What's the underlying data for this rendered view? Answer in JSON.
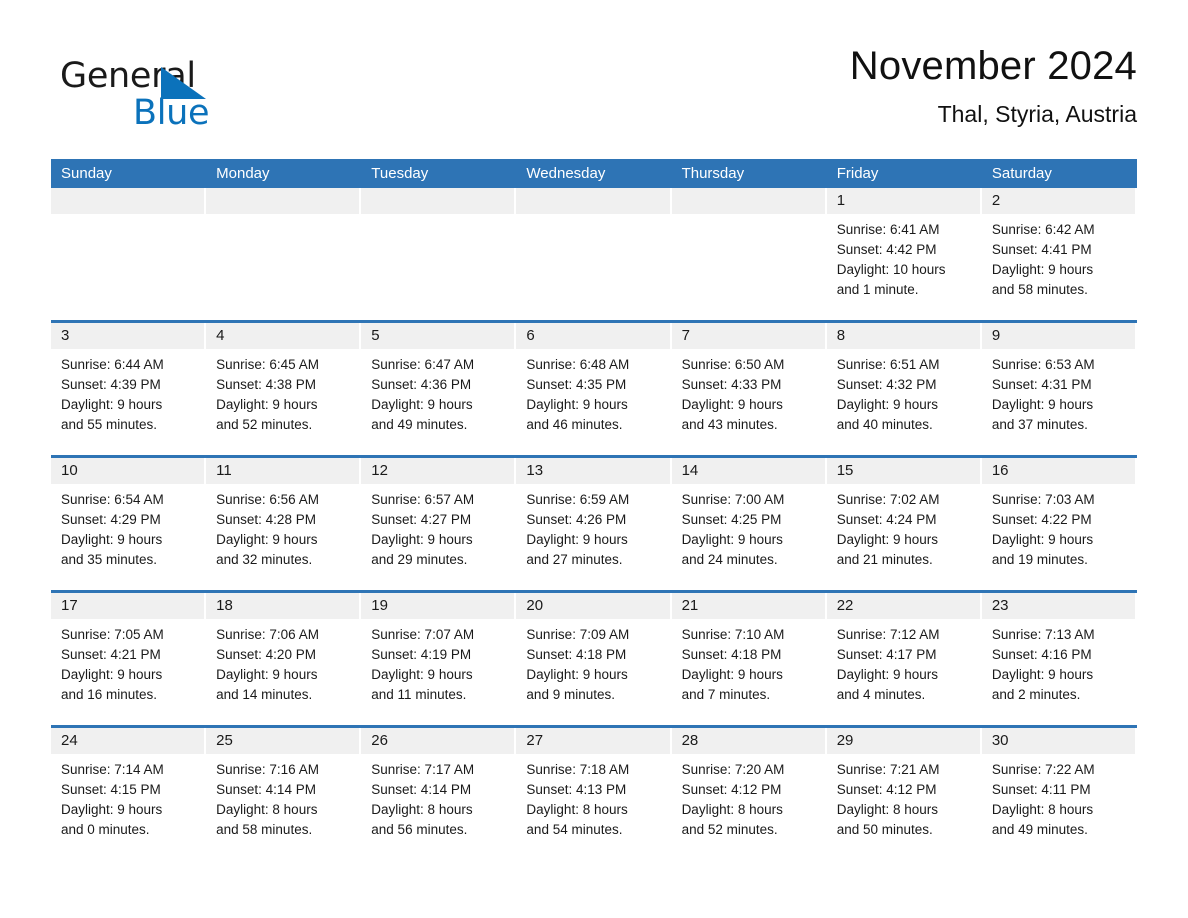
{
  "logo": {
    "word_one": "General",
    "word_two": "Blue",
    "triangle_icon": "triangle-icon",
    "brand_blue": "#0b72bb"
  },
  "header": {
    "title": "November 2024",
    "subtitle": "Thal, Styria, Austria"
  },
  "theme": {
    "header_blue": "#2e74b5",
    "daynum_band": "#f0f0f0",
    "text": "#1a1a1a"
  },
  "weekdays": [
    "Sunday",
    "Monday",
    "Tuesday",
    "Wednesday",
    "Thursday",
    "Friday",
    "Saturday"
  ],
  "weeks": [
    [
      {
        "empty": true
      },
      {
        "empty": true
      },
      {
        "empty": true
      },
      {
        "empty": true
      },
      {
        "empty": true
      },
      {
        "day": "1",
        "sunrise": "Sunrise: 6:41 AM",
        "sunset": "Sunset: 4:42 PM",
        "daylight_line1": "Daylight: 10 hours",
        "daylight_line2": "and 1 minute."
      },
      {
        "day": "2",
        "sunrise": "Sunrise: 6:42 AM",
        "sunset": "Sunset: 4:41 PM",
        "daylight_line1": "Daylight: 9 hours",
        "daylight_line2": "and 58 minutes."
      }
    ],
    [
      {
        "day": "3",
        "sunrise": "Sunrise: 6:44 AM",
        "sunset": "Sunset: 4:39 PM",
        "daylight_line1": "Daylight: 9 hours",
        "daylight_line2": "and 55 minutes."
      },
      {
        "day": "4",
        "sunrise": "Sunrise: 6:45 AM",
        "sunset": "Sunset: 4:38 PM",
        "daylight_line1": "Daylight: 9 hours",
        "daylight_line2": "and 52 minutes."
      },
      {
        "day": "5",
        "sunrise": "Sunrise: 6:47 AM",
        "sunset": "Sunset: 4:36 PM",
        "daylight_line1": "Daylight: 9 hours",
        "daylight_line2": "and 49 minutes."
      },
      {
        "day": "6",
        "sunrise": "Sunrise: 6:48 AM",
        "sunset": "Sunset: 4:35 PM",
        "daylight_line1": "Daylight: 9 hours",
        "daylight_line2": "and 46 minutes."
      },
      {
        "day": "7",
        "sunrise": "Sunrise: 6:50 AM",
        "sunset": "Sunset: 4:33 PM",
        "daylight_line1": "Daylight: 9 hours",
        "daylight_line2": "and 43 minutes."
      },
      {
        "day": "8",
        "sunrise": "Sunrise: 6:51 AM",
        "sunset": "Sunset: 4:32 PM",
        "daylight_line1": "Daylight: 9 hours",
        "daylight_line2": "and 40 minutes."
      },
      {
        "day": "9",
        "sunrise": "Sunrise: 6:53 AM",
        "sunset": "Sunset: 4:31 PM",
        "daylight_line1": "Daylight: 9 hours",
        "daylight_line2": "and 37 minutes."
      }
    ],
    [
      {
        "day": "10",
        "sunrise": "Sunrise: 6:54 AM",
        "sunset": "Sunset: 4:29 PM",
        "daylight_line1": "Daylight: 9 hours",
        "daylight_line2": "and 35 minutes."
      },
      {
        "day": "11",
        "sunrise": "Sunrise: 6:56 AM",
        "sunset": "Sunset: 4:28 PM",
        "daylight_line1": "Daylight: 9 hours",
        "daylight_line2": "and 32 minutes."
      },
      {
        "day": "12",
        "sunrise": "Sunrise: 6:57 AM",
        "sunset": "Sunset: 4:27 PM",
        "daylight_line1": "Daylight: 9 hours",
        "daylight_line2": "and 29 minutes."
      },
      {
        "day": "13",
        "sunrise": "Sunrise: 6:59 AM",
        "sunset": "Sunset: 4:26 PM",
        "daylight_line1": "Daylight: 9 hours",
        "daylight_line2": "and 27 minutes."
      },
      {
        "day": "14",
        "sunrise": "Sunrise: 7:00 AM",
        "sunset": "Sunset: 4:25 PM",
        "daylight_line1": "Daylight: 9 hours",
        "daylight_line2": "and 24 minutes."
      },
      {
        "day": "15",
        "sunrise": "Sunrise: 7:02 AM",
        "sunset": "Sunset: 4:24 PM",
        "daylight_line1": "Daylight: 9 hours",
        "daylight_line2": "and 21 minutes."
      },
      {
        "day": "16",
        "sunrise": "Sunrise: 7:03 AM",
        "sunset": "Sunset: 4:22 PM",
        "daylight_line1": "Daylight: 9 hours",
        "daylight_line2": "and 19 minutes."
      }
    ],
    [
      {
        "day": "17",
        "sunrise": "Sunrise: 7:05 AM",
        "sunset": "Sunset: 4:21 PM",
        "daylight_line1": "Daylight: 9 hours",
        "daylight_line2": "and 16 minutes."
      },
      {
        "day": "18",
        "sunrise": "Sunrise: 7:06 AM",
        "sunset": "Sunset: 4:20 PM",
        "daylight_line1": "Daylight: 9 hours",
        "daylight_line2": "and 14 minutes."
      },
      {
        "day": "19",
        "sunrise": "Sunrise: 7:07 AM",
        "sunset": "Sunset: 4:19 PM",
        "daylight_line1": "Daylight: 9 hours",
        "daylight_line2": "and 11 minutes."
      },
      {
        "day": "20",
        "sunrise": "Sunrise: 7:09 AM",
        "sunset": "Sunset: 4:18 PM",
        "daylight_line1": "Daylight: 9 hours",
        "daylight_line2": "and 9 minutes."
      },
      {
        "day": "21",
        "sunrise": "Sunrise: 7:10 AM",
        "sunset": "Sunset: 4:18 PM",
        "daylight_line1": "Daylight: 9 hours",
        "daylight_line2": "and 7 minutes."
      },
      {
        "day": "22",
        "sunrise": "Sunrise: 7:12 AM",
        "sunset": "Sunset: 4:17 PM",
        "daylight_line1": "Daylight: 9 hours",
        "daylight_line2": "and 4 minutes."
      },
      {
        "day": "23",
        "sunrise": "Sunrise: 7:13 AM",
        "sunset": "Sunset: 4:16 PM",
        "daylight_line1": "Daylight: 9 hours",
        "daylight_line2": "and 2 minutes."
      }
    ],
    [
      {
        "day": "24",
        "sunrise": "Sunrise: 7:14 AM",
        "sunset": "Sunset: 4:15 PM",
        "daylight_line1": "Daylight: 9 hours",
        "daylight_line2": "and 0 minutes."
      },
      {
        "day": "25",
        "sunrise": "Sunrise: 7:16 AM",
        "sunset": "Sunset: 4:14 PM",
        "daylight_line1": "Daylight: 8 hours",
        "daylight_line2": "and 58 minutes."
      },
      {
        "day": "26",
        "sunrise": "Sunrise: 7:17 AM",
        "sunset": "Sunset: 4:14 PM",
        "daylight_line1": "Daylight: 8 hours",
        "daylight_line2": "and 56 minutes."
      },
      {
        "day": "27",
        "sunrise": "Sunrise: 7:18 AM",
        "sunset": "Sunset: 4:13 PM",
        "daylight_line1": "Daylight: 8 hours",
        "daylight_line2": "and 54 minutes."
      },
      {
        "day": "28",
        "sunrise": "Sunrise: 7:20 AM",
        "sunset": "Sunset: 4:12 PM",
        "daylight_line1": "Daylight: 8 hours",
        "daylight_line2": "and 52 minutes."
      },
      {
        "day": "29",
        "sunrise": "Sunrise: 7:21 AM",
        "sunset": "Sunset: 4:12 PM",
        "daylight_line1": "Daylight: 8 hours",
        "daylight_line2": "and 50 minutes."
      },
      {
        "day": "30",
        "sunrise": "Sunrise: 7:22 AM",
        "sunset": "Sunset: 4:11 PM",
        "daylight_line1": "Daylight: 8 hours",
        "daylight_line2": "and 49 minutes."
      }
    ]
  ]
}
